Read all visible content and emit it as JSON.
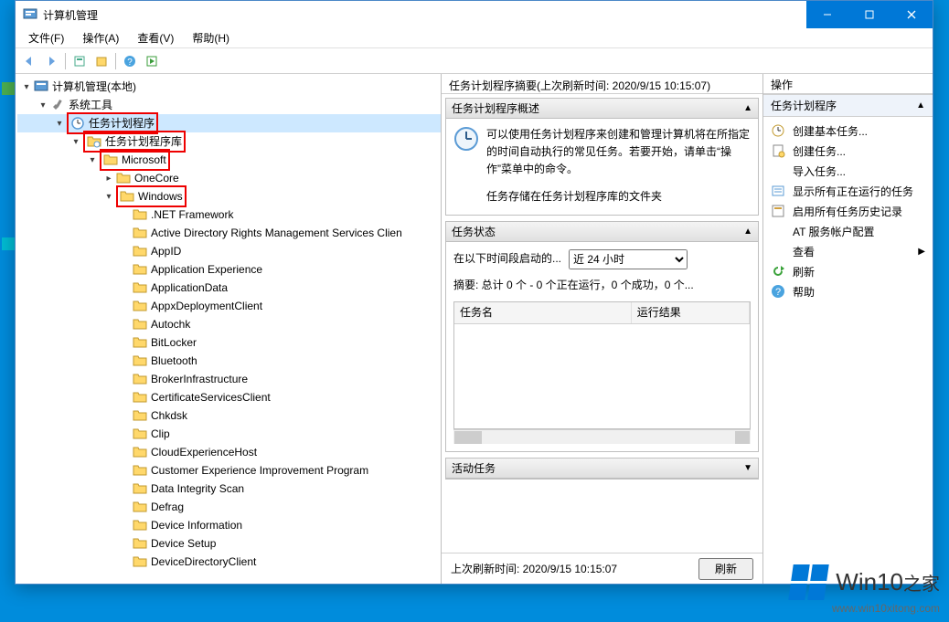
{
  "titlebar": {
    "title": "计算机管理"
  },
  "menubar": {
    "file": "文件(F)",
    "action": "操作(A)",
    "view": "查看(V)",
    "help": "帮助(H)"
  },
  "tree": {
    "root": "计算机管理(本地)",
    "system_tools": "系统工具",
    "task_scheduler": "任务计划程序",
    "task_scheduler_lib": "任务计划程序库",
    "microsoft": "Microsoft",
    "onecore": "OneCore",
    "windows": "Windows",
    "win_children": [
      ".NET Framework",
      "Active Directory Rights Management Services Clien",
      "AppID",
      "Application Experience",
      "ApplicationData",
      "AppxDeploymentClient",
      "Autochk",
      "BitLocker",
      "Bluetooth",
      "BrokerInfrastructure",
      "CertificateServicesClient",
      "Chkdsk",
      "Clip",
      "CloudExperienceHost",
      "Customer Experience Improvement Program",
      "Data Integrity Scan",
      "Defrag",
      "Device Information",
      "Device Setup",
      "DeviceDirectoryClient"
    ]
  },
  "center": {
    "header": "任务计划程序摘要(上次刷新时间: 2020/9/15 10:15:07)",
    "overview_title": "任务计划程序概述",
    "overview_text": "可以使用任务计划程序来创建和管理计算机将在所指定的时间自动执行的常见任务。若要开始，请单击“操作”菜单中的命令。",
    "overview_text2": "任务存储在任务计划程序库的文件夹",
    "status_title": "任务状态",
    "status_label": "在以下时间段启动的...",
    "status_select": "近 24 小时",
    "summary_line": "摘要: 总计 0 个 - 0 个正在运行，0 个成功，0 个...",
    "task_col_name": "任务名",
    "task_col_result": "运行结果",
    "active_tasks_title": "活动任务",
    "footer_time": "上次刷新时间: 2020/9/15 10:15:07",
    "refresh_btn": "刷新"
  },
  "actions": {
    "pane_title": "操作",
    "section_title": "任务计划程序",
    "items": {
      "create_basic": "创建基本任务...",
      "create_task": "创建任务...",
      "import_task": "导入任务...",
      "show_running": "显示所有正在运行的任务",
      "enable_history": "启用所有任务历史记录",
      "at_account": "AT 服务帐户配置",
      "view": "查看",
      "refresh": "刷新",
      "help": "帮助"
    }
  },
  "watermark": {
    "brand": "Win10",
    "suffix": "之家",
    "url": "www.win10xitong.com"
  }
}
